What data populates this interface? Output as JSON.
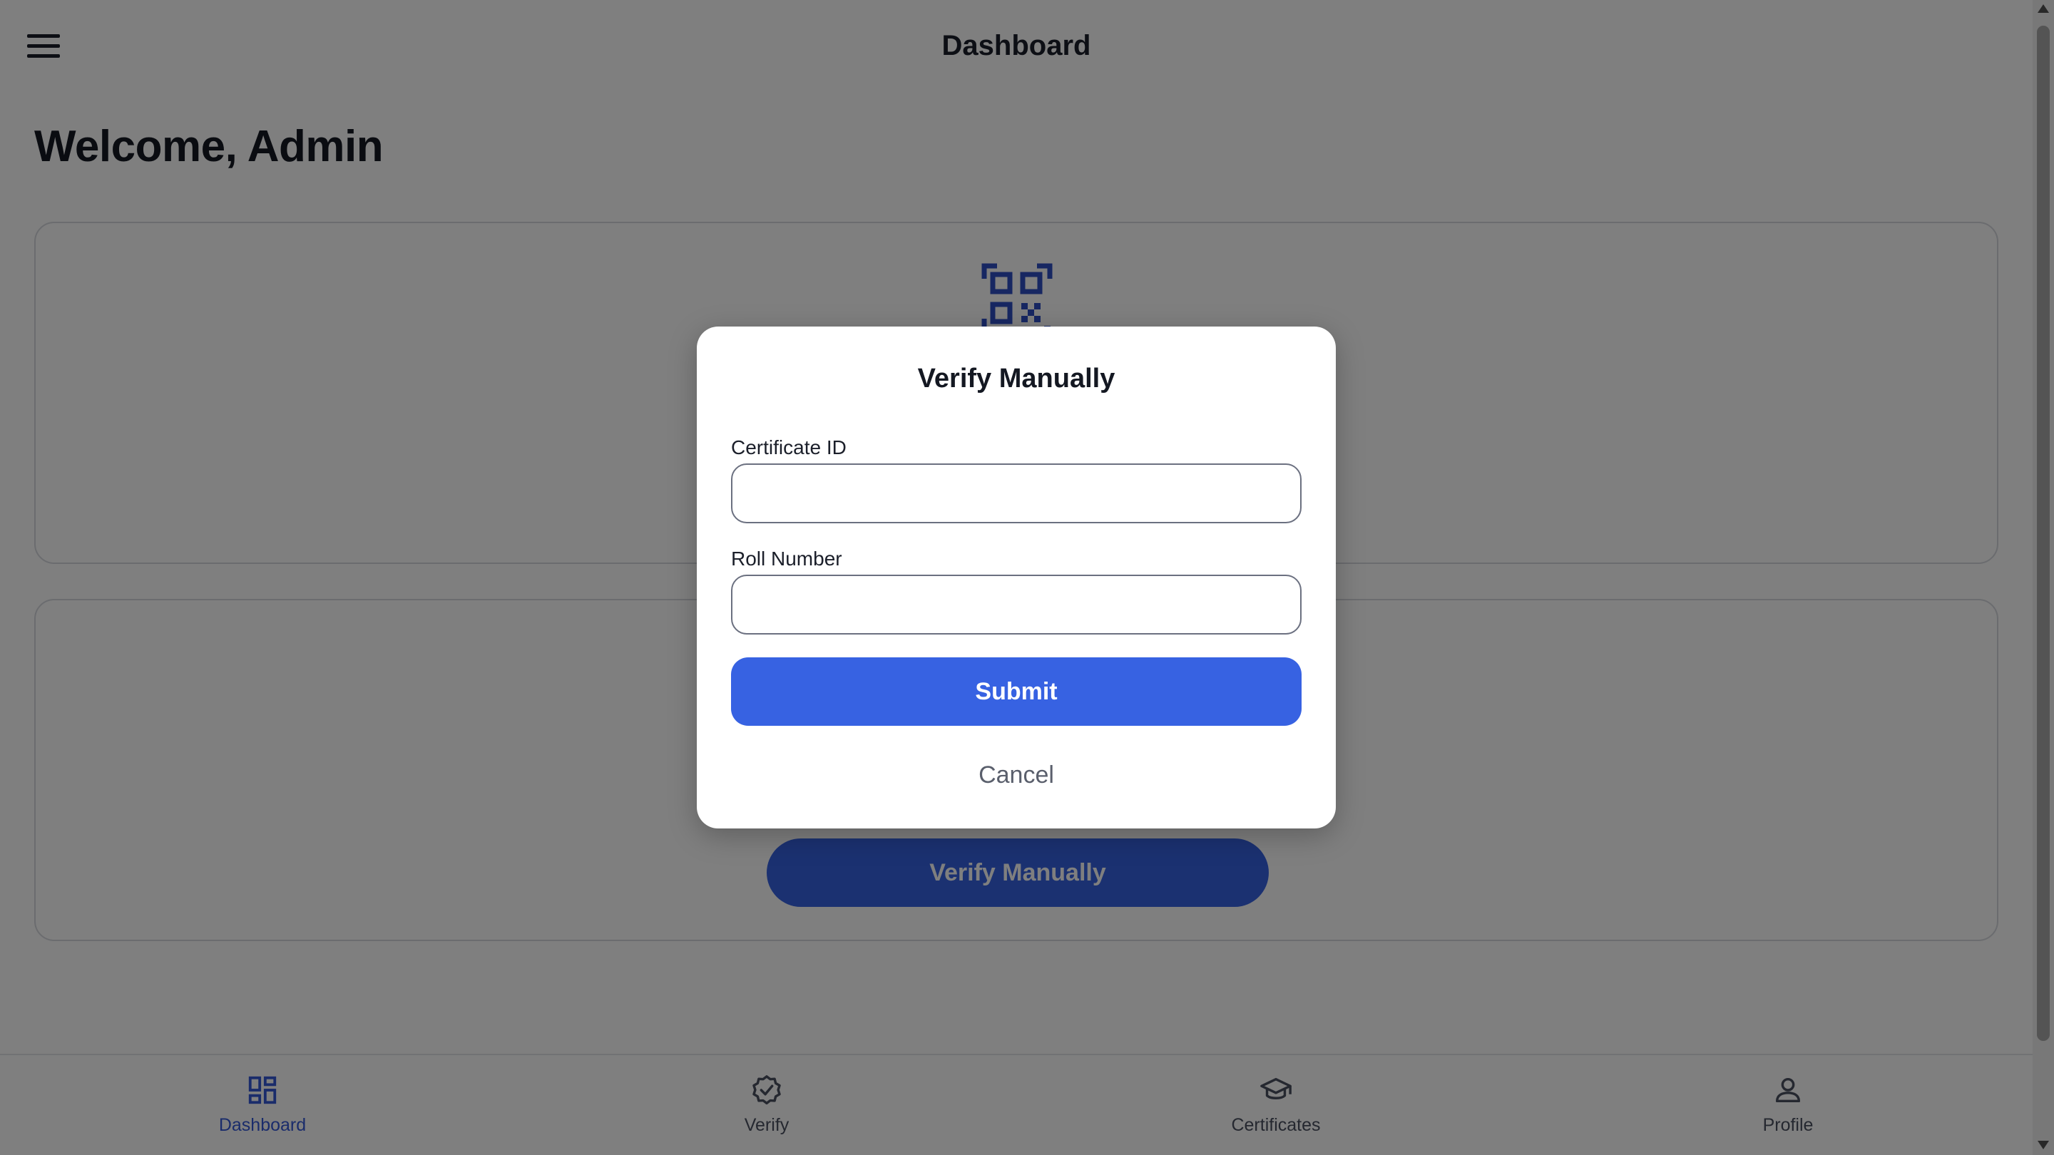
{
  "appbar": {
    "title": "Dashboard",
    "menu_icon": "menu-icon"
  },
  "welcome": "Welcome, Admin",
  "scan_card": {
    "icon": "qr-code-icon"
  },
  "manual_card": {
    "button_label": "Verify Manually"
  },
  "modal": {
    "title": "Verify Manually",
    "certificate_label": "Certificate ID",
    "certificate_value": "",
    "roll_label": "Roll Number",
    "roll_value": "",
    "submit_label": "Submit",
    "cancel_label": "Cancel"
  },
  "bottom_nav": {
    "items": [
      {
        "label": "Dashboard",
        "icon": "dashboard-icon",
        "active": true
      },
      {
        "label": "Verify",
        "icon": "verified-badge-icon",
        "active": false
      },
      {
        "label": "Certificates",
        "icon": "graduation-cap-icon",
        "active": false
      },
      {
        "label": "Profile",
        "icon": "person-icon",
        "active": false
      }
    ]
  },
  "colors": {
    "primary": "#3762e2",
    "primary_dark": "#1e3a8a",
    "text": "#1b1f2a",
    "overlay": "rgba(0,0,0,0.5)"
  }
}
